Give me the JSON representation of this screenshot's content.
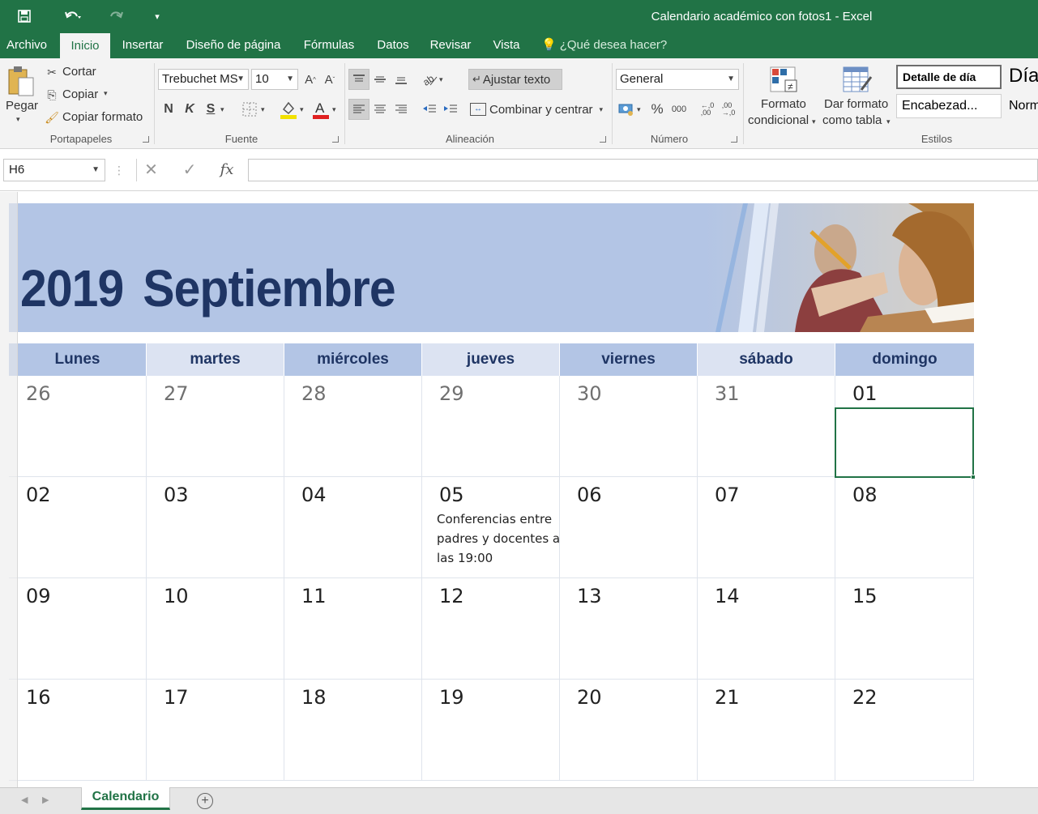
{
  "window": {
    "title": "Calendario académico con fotos1 - Excel"
  },
  "tabs": [
    "Archivo",
    "Inicio",
    "Insertar",
    "Diseño de página",
    "Fórmulas",
    "Datos",
    "Revisar",
    "Vista"
  ],
  "tell_me": "¿Qué desea hacer?",
  "ribbon": {
    "clipboard": {
      "paste": "Pegar",
      "cut": "Cortar",
      "copy": "Copiar",
      "format_painter": "Copiar formato",
      "label": "Portapapeles"
    },
    "font": {
      "name": "Trebuchet MS",
      "size": "10",
      "bold": "N",
      "italic": "K",
      "underline": "S",
      "label": "Fuente"
    },
    "alignment": {
      "wrap": "Ajustar texto",
      "merge": "Combinar y centrar",
      "label": "Alineación"
    },
    "number": {
      "format": "General",
      "percent": "%",
      "thousands": "000",
      "label": "Número"
    },
    "styles": {
      "conditional": [
        "Formato",
        "condicional"
      ],
      "as_table": [
        "Dar formato",
        "como tabla"
      ],
      "cell_styles": [
        "Detalle de día",
        "Encabezad...",
        "Día",
        "Norm"
      ],
      "label": "Estilos"
    }
  },
  "formula_bar": {
    "name_box": "H6",
    "fx": "fx",
    "content": ""
  },
  "calendar": {
    "year": "2019",
    "month": "Septiembre",
    "days": [
      "Lunes",
      "martes",
      "miércoles",
      "jueves",
      "viernes",
      "sábado",
      "domingo"
    ],
    "weeks": [
      [
        "26",
        "27",
        "28",
        "29",
        "30",
        "31",
        "01"
      ],
      [
        "02",
        "03",
        "04",
        "05",
        "06",
        "07",
        "08"
      ],
      [
        "09",
        "10",
        "11",
        "12",
        "13",
        "14",
        "15"
      ],
      [
        "16",
        "17",
        "18",
        "19",
        "20",
        "21",
        "22"
      ]
    ],
    "event": "Conferencias entre padres y docentes a las 19:00"
  },
  "sheet_tabs": [
    "Calendario"
  ],
  "colors": {
    "excel_green": "#217346",
    "banner_blue": "#b3c5e5",
    "header_light": "#dce3f2",
    "title_navy": "#1f3564"
  }
}
